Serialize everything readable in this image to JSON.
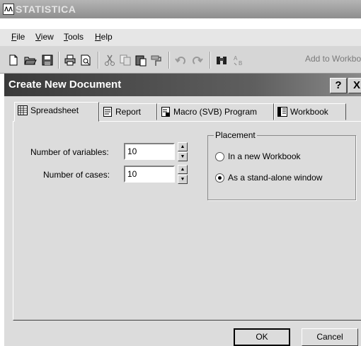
{
  "app": {
    "title": "STATISTICA",
    "icon_text": "ΛΛ"
  },
  "menu": {
    "items": [
      {
        "label": "File",
        "key": "F",
        "rest": "ile"
      },
      {
        "label": "View",
        "key": "V",
        "rest": "iew"
      },
      {
        "label": "Tools",
        "key": "T",
        "rest": "ools"
      },
      {
        "label": "Help",
        "key": "H",
        "rest": "elp"
      }
    ]
  },
  "toolbar": {
    "icons": [
      "new-document-icon",
      "open-folder-icon",
      "save-disk-icon",
      "print-icon",
      "print-preview-icon",
      "cut-icon",
      "copy-icon",
      "paste-icon",
      "format-painter-icon",
      "undo-icon",
      "redo-icon",
      "find-binoculars-icon",
      "replace-icon"
    ],
    "add_to_workbook_label": "Add to Workbook"
  },
  "dialog": {
    "title": "Create New Document",
    "help_label": "?",
    "close_label": "X",
    "tabs": [
      {
        "label": "Spreadsheet",
        "icon": "spreadsheet-icon",
        "active": true
      },
      {
        "label": "Report",
        "icon": "report-icon",
        "active": false
      },
      {
        "label": "Macro (SVB) Program",
        "icon": "macro-icon",
        "active": false
      },
      {
        "label": "Workbook",
        "icon": "workbook-icon",
        "active": false
      }
    ],
    "fields": {
      "variables_label": "Number of variables:",
      "variables_value": "10",
      "cases_label": "Number of cases:",
      "cases_value": "10"
    },
    "placement": {
      "title": "Placement",
      "options": [
        {
          "label": "In a new Workbook",
          "selected": false
        },
        {
          "label": "As a stand-alone window",
          "selected": true
        }
      ]
    },
    "ok_label": "OK",
    "cancel_label": "Cancel"
  }
}
